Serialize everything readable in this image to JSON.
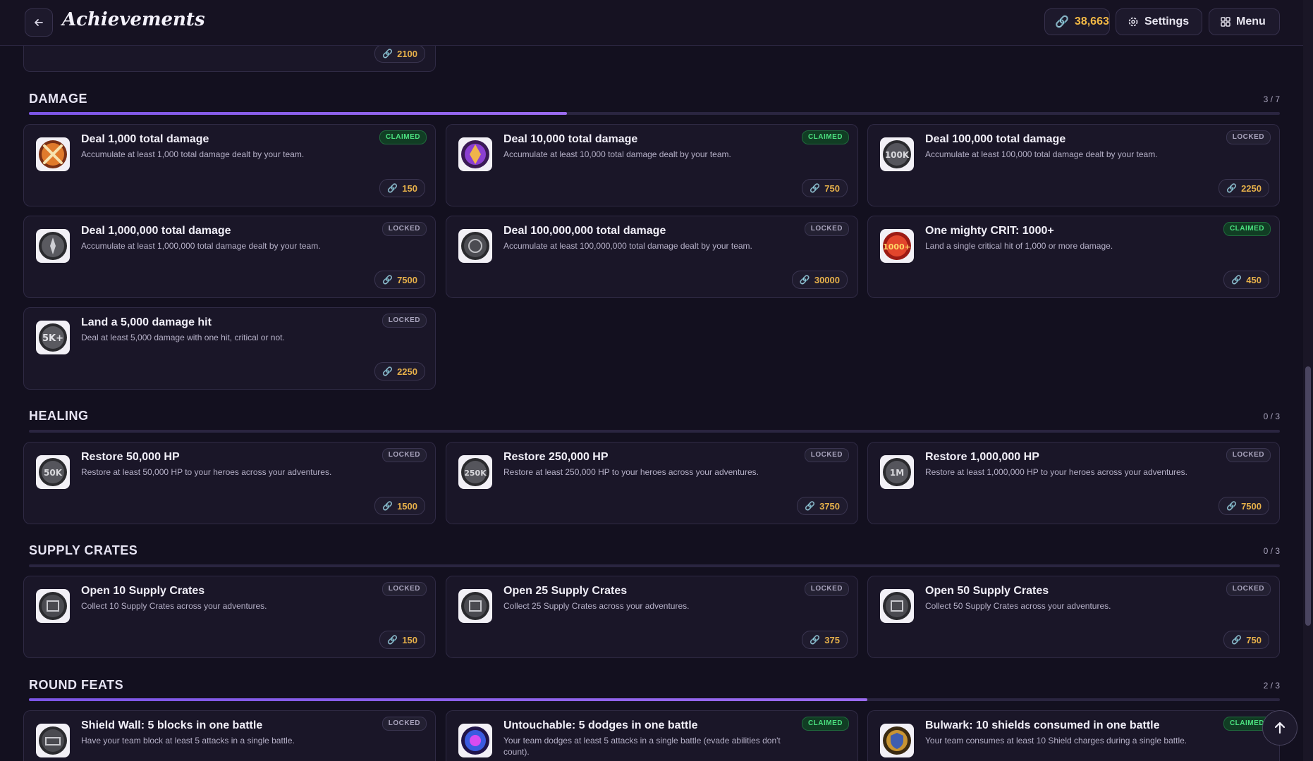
{
  "header": {
    "title": "Achievements",
    "coins": "38,663",
    "settings_label": "Settings",
    "menu_label": "Menu",
    "icons": {
      "back": "arrow-left-icon",
      "coin": "coin-icon",
      "settings": "gear-icon",
      "menu": "grid-icon"
    }
  },
  "top_partial_card": {
    "reward": "2100"
  },
  "sections": {
    "damage": {
      "title": "DAMAGE",
      "count": "3 / 7",
      "progress": 0.43,
      "cards": [
        {
          "name": "Deal 1,000 total damage",
          "desc": "Accumulate at least 1,000 total damage dealt by your team.",
          "status": "CLAIMED",
          "reward": "150",
          "icon": "crossed-swords-icon"
        },
        {
          "name": "Deal 10,000 total damage",
          "desc": "Accumulate at least 10,000 total damage dealt by your team.",
          "status": "CLAIMED",
          "reward": "750",
          "icon": "purple-gem-icon"
        },
        {
          "name": "Deal 100,000 total damage",
          "desc": "Accumulate at least 100,000 total damage dealt by your team.",
          "status": "LOCKED",
          "reward": "2250",
          "icon": "100k-medal-icon"
        },
        {
          "name": "Deal 1,000,000 total damage",
          "desc": "Accumulate at least 1,000,000 total damage dealt by your team.",
          "status": "LOCKED",
          "reward": "7500",
          "icon": "skull-medal-icon"
        },
        {
          "name": "Deal 100,000,000 total damage",
          "desc": "Accumulate at least 100,000,000 total damage dealt by your team.",
          "status": "LOCKED",
          "reward": "30000",
          "icon": "emblem-icon"
        },
        {
          "name": "One mighty CRIT: 1000+",
          "desc": "Land a single critical hit of 1,000 or more damage.",
          "status": "CLAIMED",
          "reward": "450",
          "icon": "1000-crit-icon"
        },
        {
          "name": "Land a 5,000 damage hit",
          "desc": "Deal at least 5,000 damage with one hit, critical or not.",
          "status": "LOCKED",
          "reward": "2250",
          "icon": "5k-medal-icon"
        }
      ]
    },
    "healing": {
      "title": "HEALING",
      "count": "0 / 3",
      "progress": 0,
      "cards": [
        {
          "name": "Restore 50,000 HP",
          "desc": "Restore at least 50,000 HP to your heroes across your adventures.",
          "status": "LOCKED",
          "reward": "1500",
          "icon": "50k-medal-icon"
        },
        {
          "name": "Restore 250,000 HP",
          "desc": "Restore at least 250,000 HP to your heroes across your adventures.",
          "status": "LOCKED",
          "reward": "3750",
          "icon": "250k-medal-icon"
        },
        {
          "name": "Restore 1,000,000 HP",
          "desc": "Restore at least 1,000,000 HP to your heroes across your adventures.",
          "status": "LOCKED",
          "reward": "7500",
          "icon": "1m-medal-icon"
        }
      ]
    },
    "supply": {
      "title": "SUPPLY CRATES",
      "count": "0 / 3",
      "progress": 0,
      "cards": [
        {
          "name": "Open 10 Supply Crates",
          "desc": "Collect 10 Supply Crates across your adventures.",
          "status": "LOCKED",
          "reward": "150",
          "icon": "crate-medal-icon"
        },
        {
          "name": "Open 25 Supply Crates",
          "desc": "Collect 25 Supply Crates across your adventures.",
          "status": "LOCKED",
          "reward": "375",
          "icon": "crate-medal-icon"
        },
        {
          "name": "Open 50 Supply Crates",
          "desc": "Collect 50 Supply Crates across your adventures.",
          "status": "LOCKED",
          "reward": "750",
          "icon": "crate-medal-icon"
        }
      ]
    },
    "round": {
      "title": "ROUND FEATS",
      "count": "2 / 3",
      "progress": 0.67,
      "cards": [
        {
          "name": "Shield Wall: 5 blocks in one battle",
          "desc": "Have your team block at least 5 attacks in a single battle.",
          "status": "LOCKED",
          "reward": "",
          "icon": "shield-wall-icon"
        },
        {
          "name": "Untouchable: 5 dodges in one battle",
          "desc": "Your team dodges at least 5 attacks in a single battle (evade abilities don't count).",
          "status": "CLAIMED",
          "reward": "",
          "icon": "swirl-orb-icon"
        },
        {
          "name": "Bulwark: 10 shields consumed in one battle",
          "desc": "Your team consumes at least 10 Shield charges during a single battle.",
          "status": "CLAIMED",
          "reward": "",
          "icon": "bulwark-shield-icon"
        }
      ]
    }
  },
  "colors": {
    "background": "#13101f",
    "card": "#1a1628",
    "accent": "#8b5cf6",
    "claimed": "#4be07f",
    "coin": "#f2b845"
  }
}
